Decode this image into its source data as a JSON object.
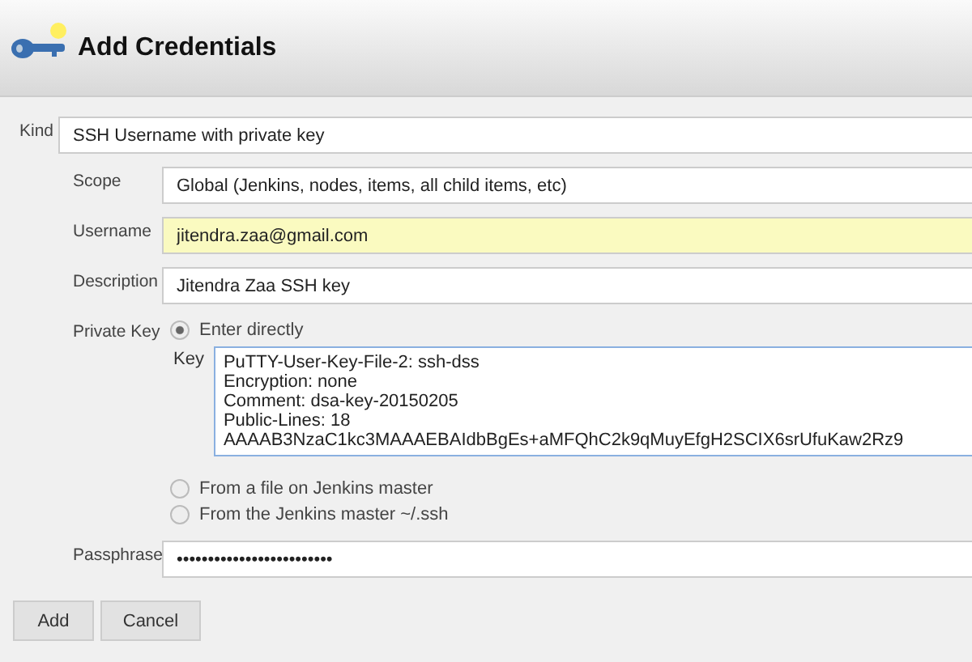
{
  "header": {
    "title": "Add Credentials"
  },
  "kind": {
    "label": "Kind",
    "value": "SSH Username with private key"
  },
  "fields": [
    {
      "label": "Scope",
      "value": "Global (Jenkins, nodes, items, all child items, etc)",
      "highlighted": false
    },
    {
      "label": "Username",
      "value": "jitendra.zaa@gmail.com",
      "highlighted": true
    },
    {
      "label": "Description",
      "value": "Jitendra Zaa SSH key",
      "highlighted": false
    }
  ],
  "private_key": {
    "label": "Private Key",
    "key_label": "Key",
    "key_value": "PuTTY-User-Key-File-2: ssh-dss\nEncryption: none\nComment: dsa-key-20150205\nPublic-Lines: 18\nAAAAB3NzaC1kc3MAAAEBAIdbBgEs+aMFQhC2k9qMuyEfgH2SCIX6srUfuKaw2Rz9",
    "options": [
      {
        "label": "Enter directly",
        "selected": true
      },
      {
        "label": "From a file on Jenkins master",
        "selected": false
      },
      {
        "label": "From the Jenkins master ~/.ssh",
        "selected": false
      }
    ]
  },
  "passphrase": {
    "label": "Passphrase",
    "value": "•••••••••••••••••••••••••"
  },
  "buttons": [
    "Add",
    "Cancel"
  ]
}
